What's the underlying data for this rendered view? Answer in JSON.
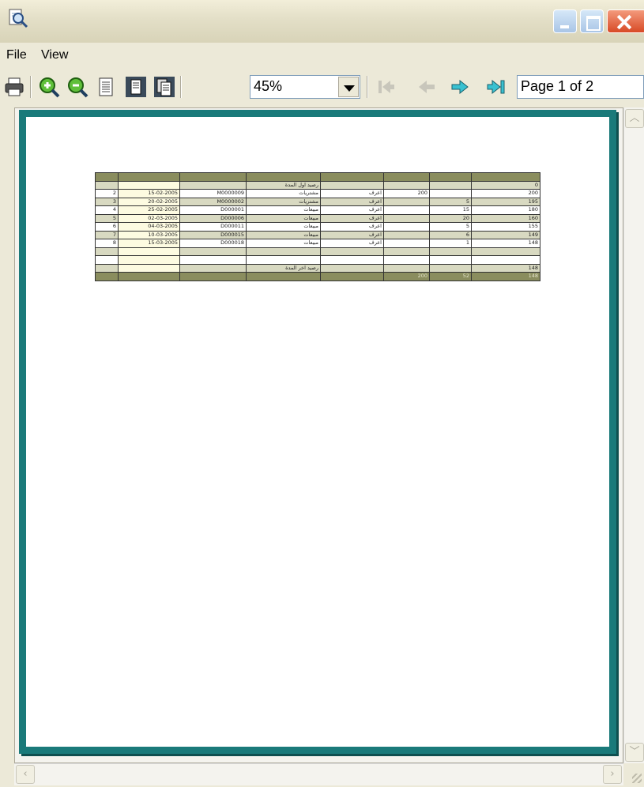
{
  "window": {
    "title": ""
  },
  "menu": {
    "file": "File",
    "view": "View"
  },
  "toolbar": {
    "icons": [
      "printer-icon",
      "zoom-in-icon",
      "zoom-out-icon",
      "page-icon",
      "single-page-icon",
      "multi-page-icon",
      "first-page-icon",
      "previous-page-icon",
      "next-page-icon",
      "last-page-icon"
    ],
    "zoom": "45%",
    "page_indicator": "Page 1 of 2"
  },
  "colors": {
    "page_border": "#1a7a7a",
    "header_fill": "#8a8d5e",
    "band_fill": "#d8d9c1",
    "date_column_fill": "#fdfbe1"
  },
  "report": {
    "headers": [
      "",
      "",
      "",
      "",
      "",
      "",
      "",
      ""
    ],
    "rows": [
      {
        "band": true,
        "cells": [
          "",
          "",
          "",
          "رصيد اول المدة",
          "",
          "",
          "",
          "0"
        ]
      },
      {
        "band": false,
        "cells": [
          "2",
          "15-02-2005",
          "M0000009",
          "مشتريات",
          "اعرف",
          "200",
          "",
          "200"
        ]
      },
      {
        "band": true,
        "cells": [
          "3",
          "20-02-2005",
          "M0000002",
          "مشتريات",
          "اعرف",
          "",
          "5",
          "195"
        ]
      },
      {
        "band": false,
        "cells": [
          "4",
          "25-02-2005",
          "D000001",
          "مبيعات",
          "اعرف",
          "",
          "15",
          "180"
        ]
      },
      {
        "band": true,
        "cells": [
          "5",
          "02-03-2005",
          "D000006",
          "مبيعات",
          "اعرف",
          "",
          "20",
          "160"
        ]
      },
      {
        "band": false,
        "cells": [
          "6",
          "04-03-2005",
          "D000011",
          "مبيعات",
          "اعرف",
          "",
          "5",
          "155"
        ]
      },
      {
        "band": true,
        "cells": [
          "7",
          "10-03-2005",
          "D000015",
          "مبيعات",
          "اعرف",
          "",
          "6",
          "149"
        ]
      },
      {
        "band": false,
        "cells": [
          "8",
          "15-03-2005",
          "D000018",
          "مبيعات",
          "اعرف",
          "",
          "1",
          "148"
        ]
      },
      {
        "band": true,
        "cells": [
          "",
          "",
          "",
          "",
          "",
          "",
          "",
          ""
        ]
      },
      {
        "band": false,
        "cells": [
          "",
          "",
          "",
          "",
          "",
          "",
          "",
          ""
        ]
      },
      {
        "band": true,
        "cells": [
          "",
          "",
          "",
          "رصيد اخر المدة",
          "",
          "",
          "",
          "148"
        ]
      }
    ],
    "footer": [
      "",
      "",
      "",
      "",
      "",
      "200",
      "52",
      "148"
    ]
  }
}
